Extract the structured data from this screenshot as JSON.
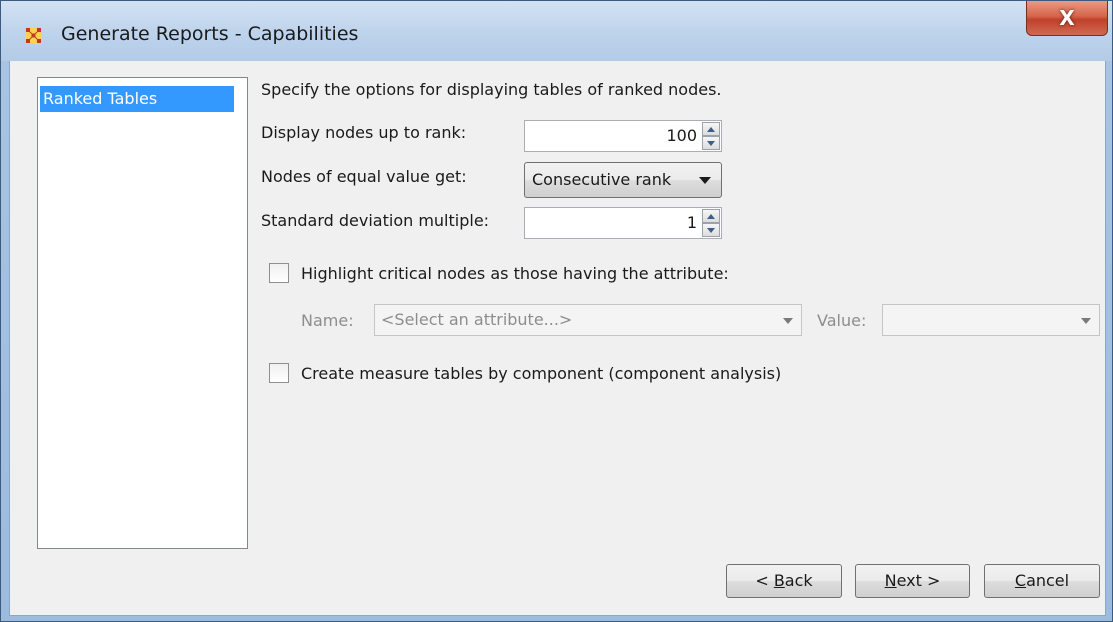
{
  "window": {
    "title": "Generate Reports - Capabilities",
    "close_glyph": "X"
  },
  "nav": {
    "items": [
      {
        "label": "Ranked Tables",
        "selected": true
      }
    ]
  },
  "main": {
    "description": "Specify the options for displaying tables of ranked nodes.",
    "display_rank": {
      "label": "Display nodes up to rank:",
      "value": "100"
    },
    "equal_value": {
      "label": "Nodes of equal value get:",
      "selected": "Consecutive rank"
    },
    "std_dev": {
      "label": "Standard deviation multiple:",
      "value": "1"
    },
    "highlight": {
      "label": "Highlight critical nodes as those having the attribute:",
      "checked": false,
      "name_label": "Name:",
      "name_placeholder": "<Select an attribute...>",
      "value_label": "Value:",
      "value_selected": ""
    },
    "component": {
      "label": "Create measure tables by component (component analysis)",
      "checked": false
    }
  },
  "footer": {
    "back": {
      "mnemonic": "B",
      "prefix": "< ",
      "rest": "ack"
    },
    "next": {
      "mnemonic": "N",
      "prefix": "",
      "rest": "ext >"
    },
    "cancel": {
      "mnemonic": "C",
      "prefix": "",
      "rest": "ancel"
    }
  },
  "colors": {
    "selection": "#3399ff",
    "close_button": "#c9503a",
    "dialog_bg": "#f0f0f0"
  },
  "icons": {
    "app": "network-grid-icon",
    "spinner_up": "triangle-up-icon",
    "spinner_down": "triangle-down-icon",
    "dropdown": "triangle-down-icon"
  }
}
